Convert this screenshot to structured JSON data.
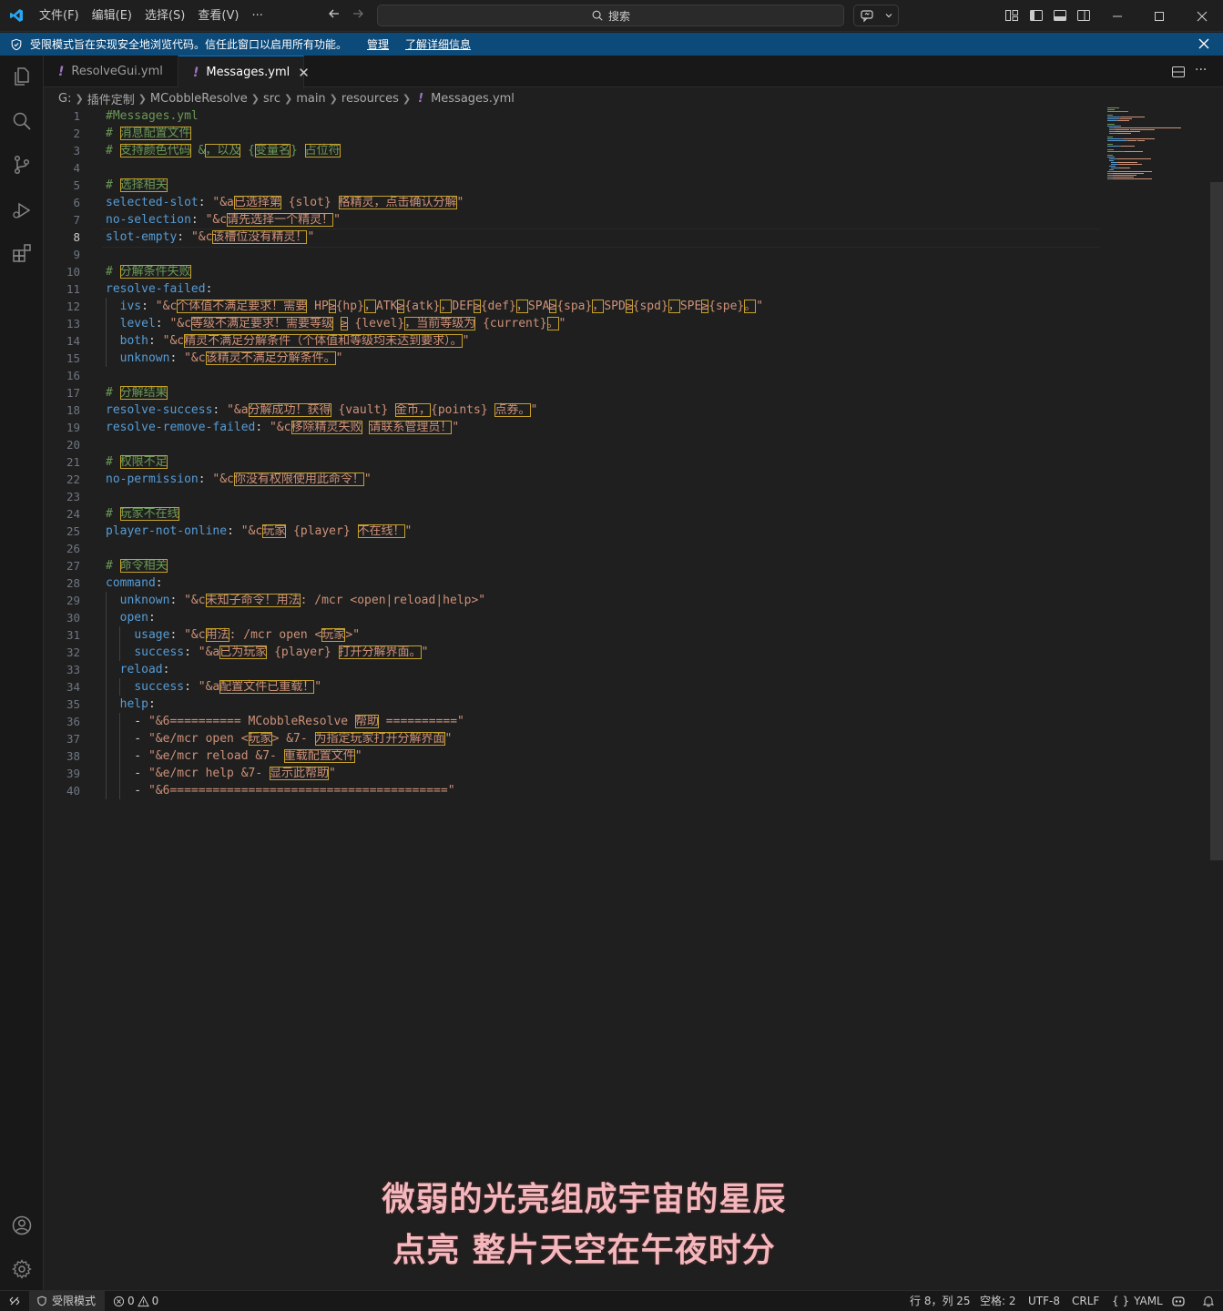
{
  "titlebar": {
    "menus": [
      "文件(F)",
      "编辑(E)",
      "选择(S)",
      "查看(V)",
      "···"
    ],
    "search_placeholder": "搜索"
  },
  "banner": {
    "message": "受限模式旨在实现安全地浏览代码。信任此窗口以启用所有功能。",
    "manage": "管理",
    "learn_more": "了解详细信息"
  },
  "tabs": [
    {
      "label": "ResolveGui.yml",
      "active": false
    },
    {
      "label": "Messages.yml",
      "active": true
    }
  ],
  "breadcrumb": [
    "G:",
    "插件定制",
    "MCobbleResolve",
    "src",
    "main",
    "resources",
    "Messages.yml"
  ],
  "editor": {
    "active_line": 8,
    "lines": [
      [
        [
          "c-com",
          "#Messages.yml"
        ]
      ],
      [
        [
          "c-com",
          "# "
        ],
        [
          "c-com c-uni",
          "消息配置文件"
        ]
      ],
      [
        [
          "c-com",
          "# "
        ],
        [
          "c-com c-uni",
          "支持颜色代码"
        ],
        [
          "c-com",
          " &"
        ],
        [
          "c-com c-uni",
          "，以及"
        ],
        [
          "c-com",
          " {"
        ],
        [
          "c-com c-uni",
          "变量名"
        ],
        [
          "c-com",
          "} "
        ],
        [
          "c-com c-uni",
          "占位符"
        ]
      ],
      [],
      [
        [
          "c-com",
          "# "
        ],
        [
          "c-com c-uni",
          "选择相关"
        ]
      ],
      [
        [
          "c-key",
          "selected-slot"
        ],
        [
          "c-pun",
          ": "
        ],
        [
          "c-str",
          "\"&a"
        ],
        [
          "c-str c-uni",
          "已选择第"
        ],
        [
          "c-str",
          " {slot} "
        ],
        [
          "c-str c-uni",
          "格精灵，点击确认分解"
        ],
        [
          "c-str",
          "\""
        ]
      ],
      [
        [
          "c-key",
          "no-selection"
        ],
        [
          "c-pun",
          ": "
        ],
        [
          "c-str",
          "\"&c"
        ],
        [
          "c-str c-uni",
          "请先选择一个精灵！"
        ],
        [
          "c-str",
          "\""
        ]
      ],
      [
        [
          "c-key",
          "slot-empty"
        ],
        [
          "c-pun",
          ": "
        ],
        [
          "c-str",
          "\"&c"
        ],
        [
          "c-str c-uni",
          "该槽位没有精灵！"
        ],
        [
          "c-str",
          "\""
        ]
      ],
      [],
      [
        [
          "c-com",
          "# "
        ],
        [
          "c-com c-uni",
          "分解条件失败"
        ]
      ],
      [
        [
          "c-key",
          "resolve-failed"
        ],
        [
          "c-pun",
          ":"
        ]
      ],
      [
        [
          "c-pun",
          "  "
        ],
        [
          "c-key",
          "ivs"
        ],
        [
          "c-pun",
          ": "
        ],
        [
          "c-str",
          "\"&c"
        ],
        [
          "c-str c-uni",
          "个体值不满足要求！需要"
        ],
        [
          "c-str",
          " HP"
        ],
        [
          "c-str c-uni",
          "≥"
        ],
        [
          "c-str",
          "{hp}"
        ],
        [
          "c-str c-uni",
          "，"
        ],
        [
          "c-str",
          "ATK"
        ],
        [
          "c-str c-uni",
          "≥"
        ],
        [
          "c-str",
          "{atk}"
        ],
        [
          "c-str c-uni",
          "，"
        ],
        [
          "c-str",
          "DEF"
        ],
        [
          "c-str c-uni",
          "≥"
        ],
        [
          "c-str",
          "{def}"
        ],
        [
          "c-str c-uni",
          "，"
        ],
        [
          "c-str",
          "SPA"
        ],
        [
          "c-str c-uni",
          "≥"
        ],
        [
          "c-str",
          "{spa}"
        ],
        [
          "c-str c-uni",
          "，"
        ],
        [
          "c-str",
          "SPD"
        ],
        [
          "c-str c-uni",
          "≥"
        ],
        [
          "c-str",
          "{spd}"
        ],
        [
          "c-str c-uni",
          "，"
        ],
        [
          "c-str",
          "SPE"
        ],
        [
          "c-str c-uni",
          "≥"
        ],
        [
          "c-str",
          "{spe}"
        ],
        [
          "c-str c-uni",
          "。"
        ],
        [
          "c-str",
          "\""
        ]
      ],
      [
        [
          "c-pun",
          "  "
        ],
        [
          "c-key",
          "level"
        ],
        [
          "c-pun",
          ": "
        ],
        [
          "c-str",
          "\"&c"
        ],
        [
          "c-str c-uni",
          "等级不满足要求！需要等级"
        ],
        [
          "c-str",
          " "
        ],
        [
          "c-str c-uni",
          "≥"
        ],
        [
          "c-str",
          " {level}"
        ],
        [
          "c-str c-uni",
          "，当前等级为"
        ],
        [
          "c-str",
          " {current}"
        ],
        [
          "c-str c-uni",
          "。"
        ],
        [
          "c-str",
          "\""
        ]
      ],
      [
        [
          "c-pun",
          "  "
        ],
        [
          "c-key",
          "both"
        ],
        [
          "c-pun",
          ": "
        ],
        [
          "c-str",
          "\"&c"
        ],
        [
          "c-str c-uni",
          "精灵不满足分解条件（个体值和等级均未达到要求）。"
        ],
        [
          "c-str",
          "\""
        ]
      ],
      [
        [
          "c-pun",
          "  "
        ],
        [
          "c-key",
          "unknown"
        ],
        [
          "c-pun",
          ": "
        ],
        [
          "c-str",
          "\"&c"
        ],
        [
          "c-str c-uni",
          "该精灵不满足分解条件。"
        ],
        [
          "c-str",
          "\""
        ]
      ],
      [],
      [
        [
          "c-com",
          "# "
        ],
        [
          "c-com c-uni",
          "分解结果"
        ]
      ],
      [
        [
          "c-key",
          "resolve-success"
        ],
        [
          "c-pun",
          ": "
        ],
        [
          "c-str",
          "\"&a"
        ],
        [
          "c-str c-uni",
          "分解成功！获得"
        ],
        [
          "c-str",
          " {vault} "
        ],
        [
          "c-str c-uni",
          "金币，"
        ],
        [
          "c-str",
          "{points} "
        ],
        [
          "c-str c-uni",
          "点券。"
        ],
        [
          "c-str",
          "\""
        ]
      ],
      [
        [
          "c-key",
          "resolve-remove-failed"
        ],
        [
          "c-pun",
          ": "
        ],
        [
          "c-str",
          "\"&c"
        ],
        [
          "c-str c-uni",
          "移除精灵失败"
        ],
        [
          "c-str",
          " "
        ],
        [
          "c-str c-uni",
          "请联系管理员！"
        ],
        [
          "c-str",
          "\""
        ]
      ],
      [],
      [
        [
          "c-com",
          "# "
        ],
        [
          "c-com c-uni",
          "权限不足"
        ]
      ],
      [
        [
          "c-key",
          "no-permission"
        ],
        [
          "c-pun",
          ": "
        ],
        [
          "c-str",
          "\"&c"
        ],
        [
          "c-str c-uni",
          "你没有权限使用此命令！"
        ],
        [
          "c-str",
          "\""
        ]
      ],
      [],
      [
        [
          "c-com",
          "# "
        ],
        [
          "c-com c-uni",
          "玩家不在线"
        ]
      ],
      [
        [
          "c-key",
          "player-not-online"
        ],
        [
          "c-pun",
          ": "
        ],
        [
          "c-str",
          "\"&c"
        ],
        [
          "c-str c-uni",
          "玩家"
        ],
        [
          "c-str",
          " {player} "
        ],
        [
          "c-str c-uni",
          "不在线！"
        ],
        [
          "c-str",
          "\""
        ]
      ],
      [],
      [
        [
          "c-com",
          "# "
        ],
        [
          "c-com c-uni",
          "命令相关"
        ]
      ],
      [
        [
          "c-key",
          "command"
        ],
        [
          "c-pun",
          ":"
        ]
      ],
      [
        [
          "c-pun",
          "  "
        ],
        [
          "c-key",
          "unknown"
        ],
        [
          "c-pun",
          ": "
        ],
        [
          "c-str",
          "\"&c"
        ],
        [
          "c-str c-uni",
          "未知子命令！用法"
        ],
        [
          "c-str",
          ": /mcr <open|reload|help>\""
        ]
      ],
      [
        [
          "c-pun",
          "  "
        ],
        [
          "c-key",
          "open"
        ],
        [
          "c-pun",
          ":"
        ]
      ],
      [
        [
          "c-pun",
          "    "
        ],
        [
          "c-key",
          "usage"
        ],
        [
          "c-pun",
          ": "
        ],
        [
          "c-str",
          "\"&c"
        ],
        [
          "c-str c-uni",
          "用法"
        ],
        [
          "c-str",
          ": /mcr open <"
        ],
        [
          "c-str c-uni",
          "玩家"
        ],
        [
          "c-str",
          ">\""
        ]
      ],
      [
        [
          "c-pun",
          "    "
        ],
        [
          "c-key",
          "success"
        ],
        [
          "c-pun",
          ": "
        ],
        [
          "c-str",
          "\"&a"
        ],
        [
          "c-str c-uni",
          "已为玩家"
        ],
        [
          "c-str",
          " {player} "
        ],
        [
          "c-str c-uni",
          "打开分解界面。"
        ],
        [
          "c-str",
          "\""
        ]
      ],
      [
        [
          "c-pun",
          "  "
        ],
        [
          "c-key",
          "reload"
        ],
        [
          "c-pun",
          ":"
        ]
      ],
      [
        [
          "c-pun",
          "    "
        ],
        [
          "c-key",
          "success"
        ],
        [
          "c-pun",
          ": "
        ],
        [
          "c-str",
          "\"&a"
        ],
        [
          "c-str c-uni",
          "配置文件已重载！"
        ],
        [
          "c-str",
          "\""
        ]
      ],
      [
        [
          "c-pun",
          "  "
        ],
        [
          "c-key",
          "help"
        ],
        [
          "c-pun",
          ":"
        ]
      ],
      [
        [
          "c-pun",
          "    - "
        ],
        [
          "c-str",
          "\"&6========== MCobbleResolve "
        ],
        [
          "c-str c-uni",
          "帮助"
        ],
        [
          "c-str",
          " ==========\""
        ]
      ],
      [
        [
          "c-pun",
          "    - "
        ],
        [
          "c-str",
          "\"&e/mcr open <"
        ],
        [
          "c-str c-uni",
          "玩家"
        ],
        [
          "c-str",
          "> &7- "
        ],
        [
          "c-str c-uni",
          "为指定玩家打开分解界面"
        ],
        [
          "c-str",
          "\""
        ]
      ],
      [
        [
          "c-pun",
          "    - "
        ],
        [
          "c-str",
          "\"&e/mcr reload &7- "
        ],
        [
          "c-str c-uni",
          "重载配置文件"
        ],
        [
          "c-str",
          "\""
        ]
      ],
      [
        [
          "c-pun",
          "    - "
        ],
        [
          "c-str",
          "\"&e/mcr help &7- "
        ],
        [
          "c-str c-uni",
          "显示此帮助"
        ],
        [
          "c-str",
          "\""
        ]
      ],
      [
        [
          "c-pun",
          "    - "
        ],
        [
          "c-str",
          "\"&6=======================================\""
        ]
      ]
    ]
  },
  "subtitles": {
    "line1": "微弱的光亮组成宇宙的星辰",
    "line2": "点亮 整片天空在午夜时分"
  },
  "statusbar": {
    "restricted": "受限模式",
    "errors": "0",
    "warnings": "0",
    "position": "行 8，列 25",
    "spaces": "空格: 2",
    "encoding": "UTF-8",
    "eol": "CRLF",
    "language": "YAML"
  },
  "colors": {
    "accent": "#0078d4",
    "banner": "#0c4a7a",
    "comment": "#6a9955",
    "key": "#569cd6",
    "string": "#ce9178",
    "unicode_highlight": "#c7a22a",
    "yaml_icon": "#a074c4"
  }
}
